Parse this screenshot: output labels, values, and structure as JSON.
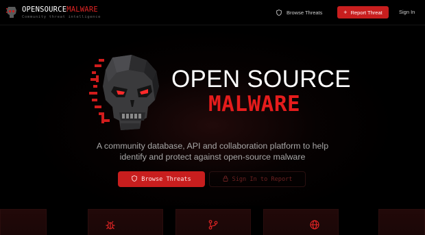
{
  "header": {
    "brand_open": "OPENSOURCE",
    "brand_malware": "MALWARE",
    "tagline": "Community threat intelligence",
    "logo_icon": "skull-icon",
    "nav": {
      "browse_label": "Browse Threats",
      "browse_icon": "shield-icon",
      "report_label": "Report Threat",
      "report_icon": "plus-icon",
      "signin_label": "Sign In"
    }
  },
  "hero": {
    "title_line1": "OPEN SOURCE",
    "title_line2": "MALWARE",
    "subtitle": "A community database, API and collaboration platform to help identify and protect against open-source malware",
    "primary_button": "Browse Threats",
    "secondary_button": "Sign In to Report",
    "mascot_icon": "glitch-skull-icon"
  },
  "features": {
    "icons": [
      "bug-icon",
      "branch-icon",
      "globe-icon"
    ]
  },
  "colors": {
    "background": "#000000",
    "accent_red": "#c81e1e",
    "title_red": "#e51c1c",
    "text_muted": "#a8a8a8"
  }
}
